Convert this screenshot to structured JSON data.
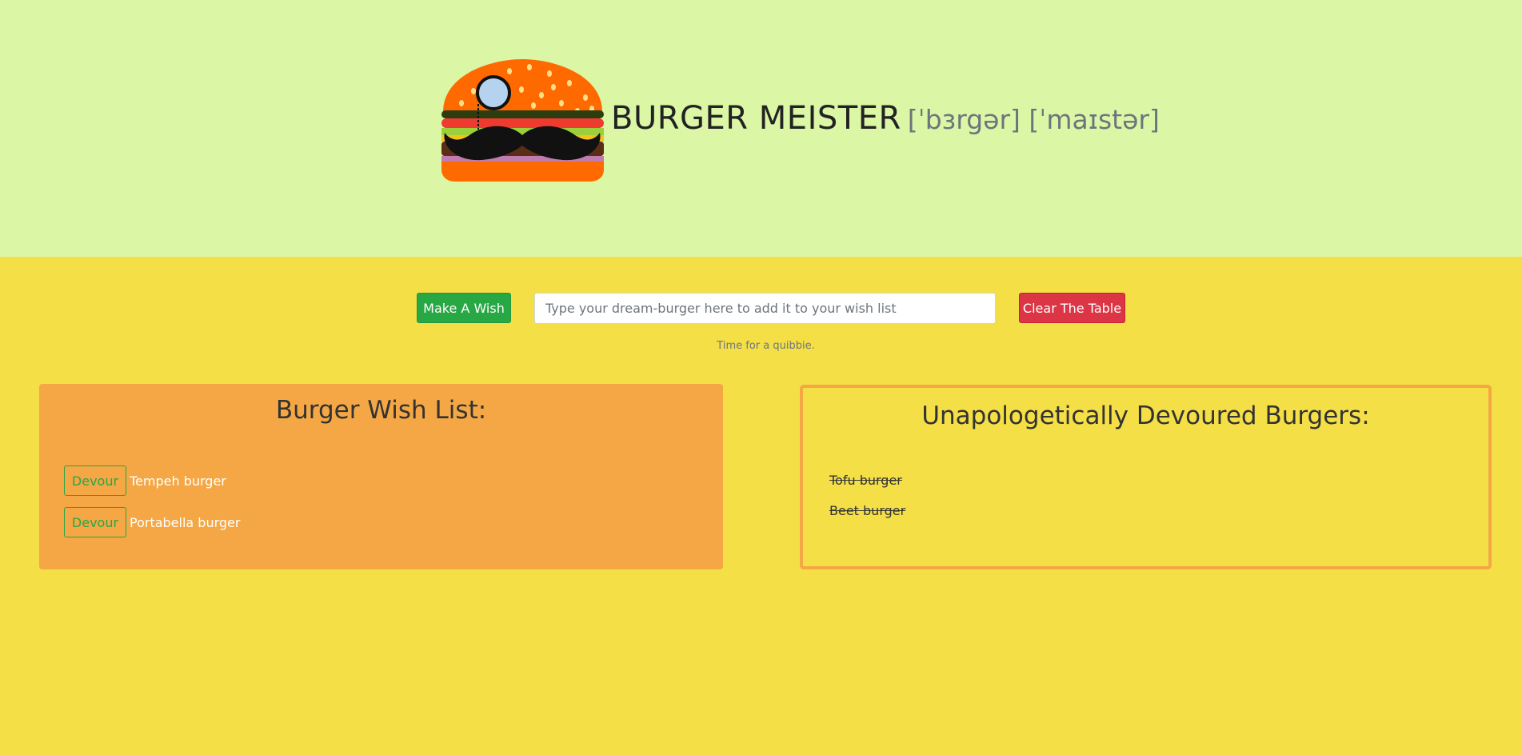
{
  "header": {
    "brand": "BURGER MEISTER",
    "phonetic": "[ˈbɜrgər] [ˈmaɪstər]",
    "logo_icon": "burger-mustache-logo"
  },
  "form": {
    "make_wish_label": "Make A Wish",
    "input_placeholder": "Type your dream-burger here to add it to your wish list",
    "input_value": "",
    "clear_label": "Clear The Table",
    "hint": "Time for a quibbie."
  },
  "wish_list": {
    "title": "Burger Wish List:",
    "items": [
      {
        "button": "Devour",
        "name": "Tempeh burger"
      },
      {
        "button": "Devour",
        "name": "Portabella burger"
      }
    ]
  },
  "devoured": {
    "title": "Unapologetically Devoured Burgers:",
    "items": [
      "Tofu burger",
      "Beet burger"
    ]
  },
  "colors": {
    "header_bg": "#dbf7a6",
    "page_bg": "#f5df47",
    "card_accent": "#f4a744",
    "success": "#28a745",
    "danger": "#dc3545"
  }
}
